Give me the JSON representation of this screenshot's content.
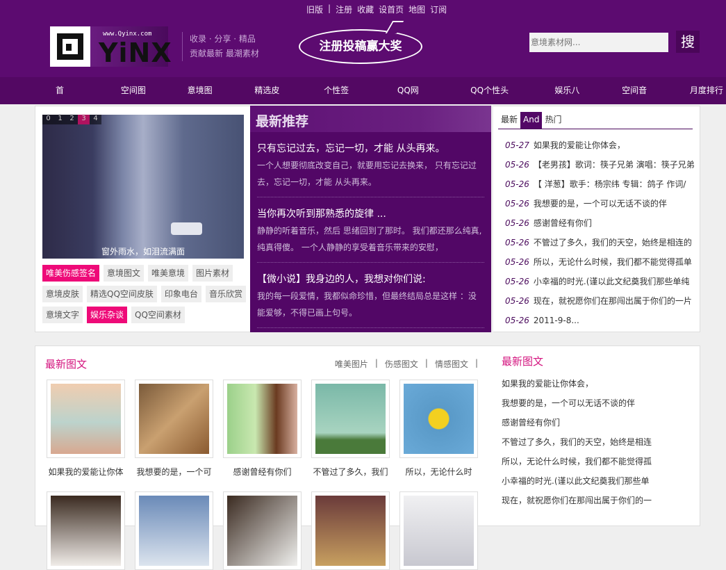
{
  "top_links": [
    "旧版",
    "|",
    "注册",
    "收藏",
    "设首页",
    "地图",
    "订阅"
  ],
  "logo": {
    "url": "www.Qyinx.com",
    "word": "YiNX"
  },
  "slogan": [
    "收录 · 分享 · 精品",
    "贡献最新 最潮素材"
  ],
  "banner": "注册投稿赢大奖",
  "search": {
    "placeholder": "意境素材网...",
    "button": "搜"
  },
  "nav": [
    "首页",
    "空间图片",
    "意境图文",
    "精选皮肤",
    "个性签名",
    "QQ网名",
    "QQ个性头像",
    "娱乐八卦",
    "空间音乐",
    "月度排行榜"
  ],
  "slider": {
    "numbers": [
      "0",
      "1",
      "2",
      "3",
      "4"
    ],
    "active": 3,
    "caption": "窗外雨水，如泪流满面"
  },
  "tags": [
    {
      "label": "唯美伤感签名",
      "hot": true
    },
    {
      "label": "意境图文"
    },
    {
      "label": "唯美意境"
    },
    {
      "label": "图片素材"
    },
    {
      "label": "意境皮肤"
    },
    {
      "label": "精选QQ空间皮肤"
    },
    {
      "label": "印象电台"
    },
    {
      "label": "音乐欣赏"
    },
    {
      "label": "意境文字"
    },
    {
      "label": "娱乐杂谈",
      "hot": true
    },
    {
      "label": "QQ空间素材"
    }
  ],
  "recommend": {
    "title": "最新推荐",
    "articles": [
      {
        "title": "只有忘记过去，忘记一切，才能 从头再来。",
        "desc": "一个人想要彻底改变自己，就要用忘记去换来， 只有忘记过去，忘记一切，才能 从头再来。"
      },
      {
        "title": "当你再次听到那熟悉的旋律 ...",
        "desc": "静静的听着音乐，然后 思绪回到了那时。 我们都还那么纯真,纯真得傻。 一个人静静的享受着音乐带来的安慰，"
      },
      {
        "title": "【微小说】我身边的人，我想对你们说:",
        "desc": "我的每一段爱情，我都似命珍惜，但最终结局总是这样 ：没能爱够，不得已画上句号。"
      }
    ]
  },
  "right_tabs": [
    "最新",
    "And",
    "热门"
  ],
  "right_list": [
    {
      "date": "05-27",
      "text": "如果我的爱能让你体会，"
    },
    {
      "date": "05-26",
      "text": "【老男孩】歌词：筷子兄弟 演唱：筷子兄弟"
    },
    {
      "date": "05-26",
      "text": "【 洋葱】歌手：杨宗纬 专辑：鸽子 作词/"
    },
    {
      "date": "05-26",
      "text": "我想要的是，一个可以无话不谈的伴"
    },
    {
      "date": "05-26",
      "text": "感谢曾经有你们"
    },
    {
      "date": "05-26",
      "text": "不管过了多久，我们的天空，始终是相连的"
    },
    {
      "date": "05-26",
      "text": "所以，无论什么时候，我们都不能觉得孤单"
    },
    {
      "date": "05-26",
      "text": "小幸福的时光.(谨以此文纪奠我们那些单纯"
    },
    {
      "date": "05-26",
      "text": "现在，就祝愿你们在那闯出属于你们的一片"
    },
    {
      "date": "05-26",
      "text": "2011-9-8..."
    }
  ],
  "gallery": {
    "title": "最新图文",
    "links": [
      "唯美图片",
      "|",
      "伤感图文",
      "|",
      "情感图文",
      "|"
    ],
    "items": [
      {
        "caption": "如果我的爱能让你体",
        "color": "linear-gradient(#f0cdb0,#bcd3cc 55%,#d8a890)"
      },
      {
        "caption": "我想要的是，一个可",
        "color": "linear-gradient(135deg,#7a5a3a,#c9a070 50%,#8a5a30)"
      },
      {
        "caption": "感谢曾经有你们",
        "color": "linear-gradient(90deg,#9bd08a,#c9e8b0 40%,#6a3a20 70%,#d8b0a0)"
      },
      {
        "caption": "不管过了多久，我们",
        "color": "linear-gradient(#7ab8a8,#a8d4c0 70%,#4a7a3a 80%)"
      },
      {
        "caption": "所以，无论什么时",
        "color": "radial-gradient(circle,#f3d020 20%,#5a9ac8 22%,#6aaad8)"
      },
      {
        "caption": "",
        "color": "linear-gradient(#3a2a20,#f0ece8)"
      },
      {
        "caption": "",
        "color": "linear-gradient(#6a8ab8,#dce4ee)"
      },
      {
        "caption": "",
        "color": "linear-gradient(135deg,#3a2a20,#f0f0ee)"
      },
      {
        "caption": "",
        "color": "linear-gradient(#6a3a3a,#c8a060)"
      },
      {
        "caption": "",
        "color": "linear-gradient(#f0f0f2,#c8c8d0)"
      }
    ]
  },
  "side_gallery": {
    "title": "最新图文",
    "items": [
      "如果我的爱能让你体会，",
      "我想要的是，一个可以无话不谈的伴",
      "感谢曾经有你们",
      "不管过了多久，我们的天空，始终是相连",
      "所以，无论什么时候，我们都不能觉得孤",
      "小幸福的时光.(谨以此文纪奠我们那些单",
      "现在，就祝愿你们在那闯出属于你们的一"
    ]
  }
}
